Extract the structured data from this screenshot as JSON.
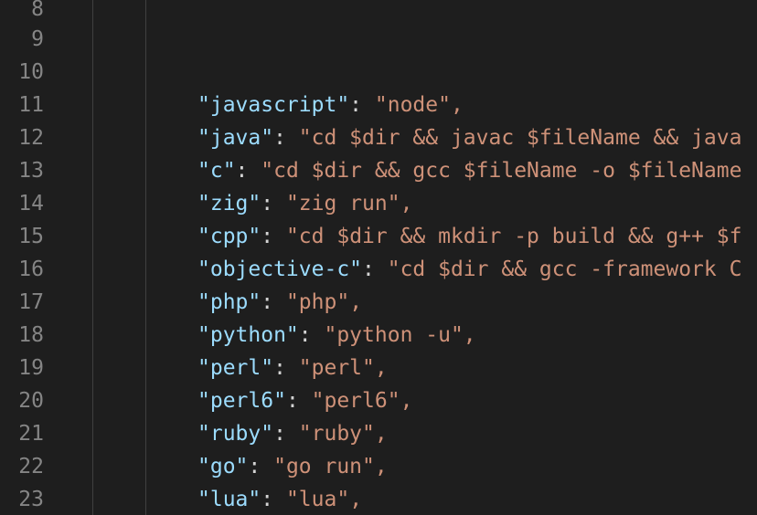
{
  "editor": {
    "line_numbers": [
      "8",
      "9",
      "10",
      "11",
      "12",
      "13",
      "14",
      "15",
      "16",
      "17",
      "18",
      "19",
      "20",
      "21",
      "22",
      "23"
    ],
    "code_lines": [
      {
        "line": 11,
        "key": "\"javascript\"",
        "value": "\"node\","
      },
      {
        "line": 12,
        "key": "\"java\"",
        "value": "\"cd $dir && javac $fileName && java"
      },
      {
        "line": 13,
        "key": "\"c\"",
        "value": "\"cd $dir && gcc $fileName -o $fileName"
      },
      {
        "line": 14,
        "key": "\"zig\"",
        "value": "\"zig run\","
      },
      {
        "line": 15,
        "key": "\"cpp\"",
        "value": "\"cd $dir && mkdir -p build && g++ $f"
      },
      {
        "line": 16,
        "key": "\"objective-c\"",
        "value": "\"cd $dir && gcc -framework C"
      },
      {
        "line": 17,
        "key": "\"php\"",
        "value": "\"php\","
      },
      {
        "line": 18,
        "key": "\"python\"",
        "value": "\"python -u\","
      },
      {
        "line": 19,
        "key": "\"perl\"",
        "value": "\"perl\","
      },
      {
        "line": 20,
        "key": "\"perl6\"",
        "value": "\"perl6\","
      },
      {
        "line": 21,
        "key": "\"ruby\"",
        "value": "\"ruby\","
      },
      {
        "line": 22,
        "key": "\"go\"",
        "value": "\"go run\","
      },
      {
        "line": 23,
        "key": "\"lua\"",
        "value": "\"lua\","
      }
    ],
    "colors": {
      "background": "#1e1e1e",
      "line_number": "#858585",
      "key": "#9cdcfe",
      "string": "#ce9178",
      "punctuation": "#d4d4d4"
    }
  }
}
